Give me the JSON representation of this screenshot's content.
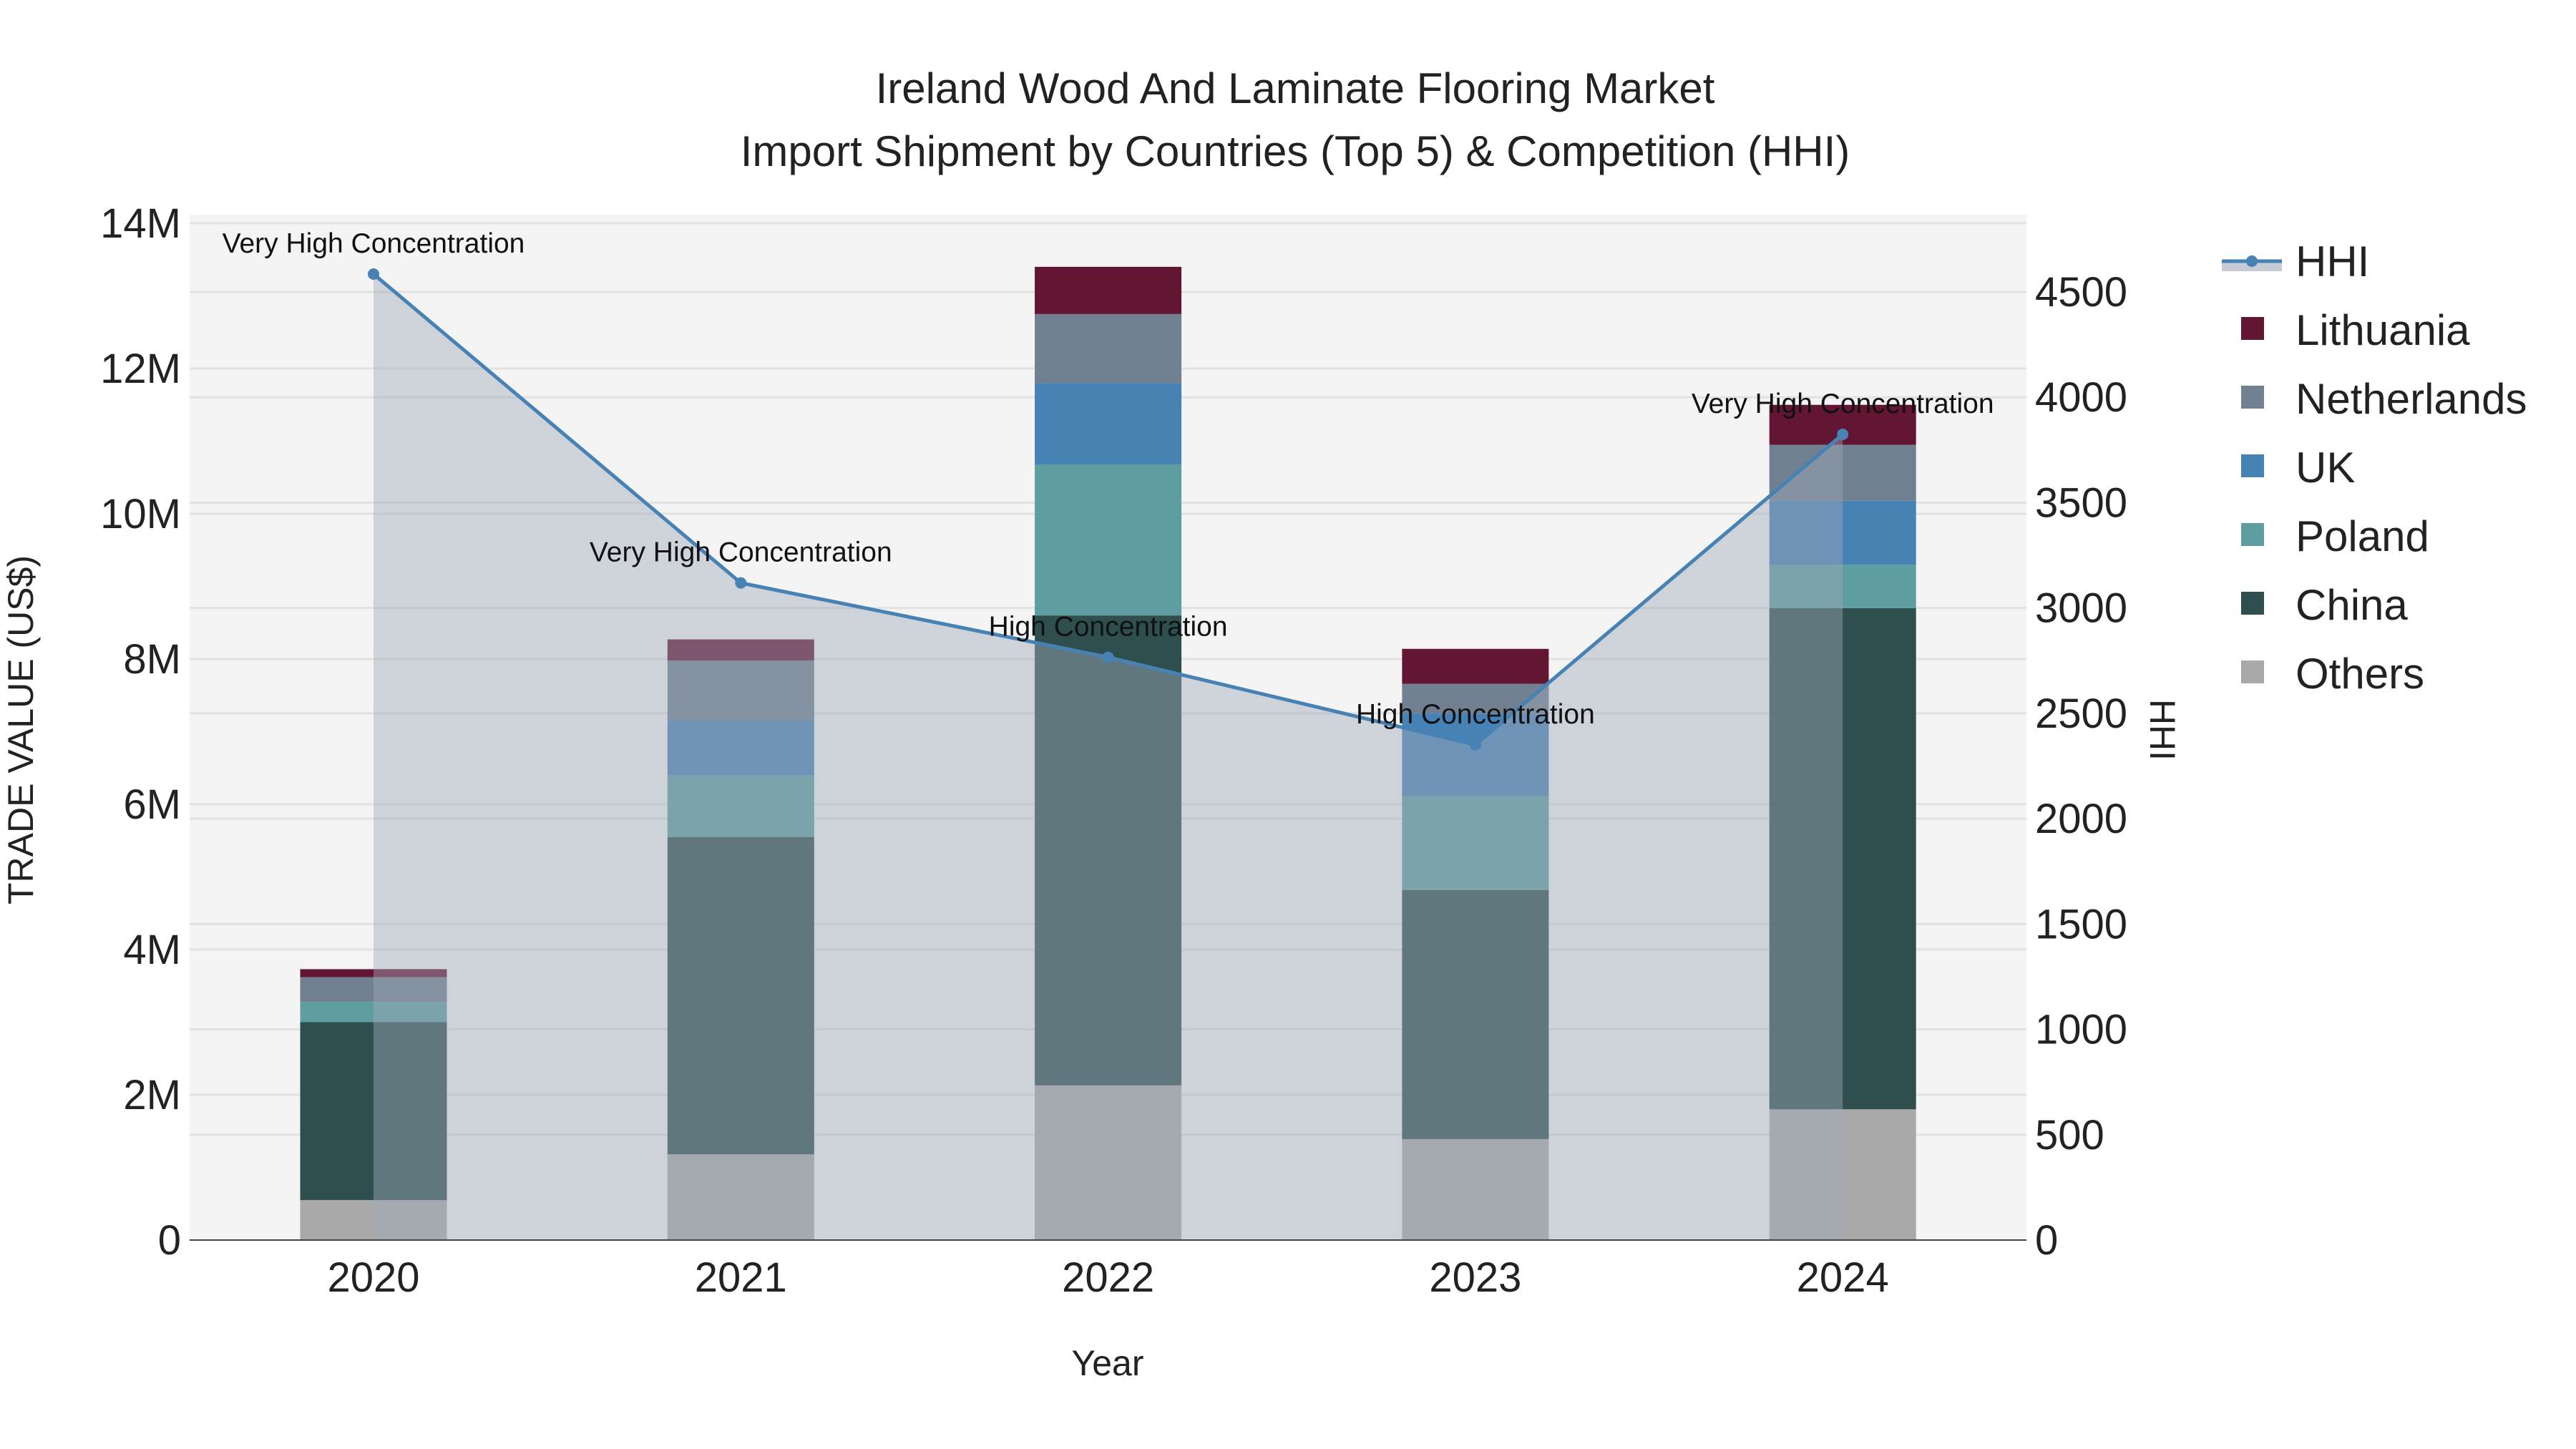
{
  "chart_data": {
    "type": "bar",
    "title": "Ireland Wood And Laminate Flooring Market",
    "subtitle": "Import Shipment by Countries (Top 5) & Competition (HHI)",
    "xlabel": "Year",
    "ylabel": "TRADE VALUE (US$)",
    "y2label": "HHI",
    "categories": [
      "2020",
      "2021",
      "2022",
      "2023",
      "2024"
    ],
    "ylim": [
      0,
      14000000
    ],
    "y_ticks": [
      0,
      2000000,
      4000000,
      6000000,
      8000000,
      10000000,
      12000000,
      14000000
    ],
    "y_tick_labels": [
      "0",
      "2M",
      "4M",
      "6M",
      "8M",
      "10M",
      "12M",
      "14M"
    ],
    "y2lim": [
      0,
      4850
    ],
    "y2_ticks": [
      0,
      500,
      1000,
      1500,
      2000,
      2500,
      3000,
      3500,
      4000,
      4500
    ],
    "y2_tick_labels": [
      "0",
      "500",
      "1000",
      "1500",
      "2000",
      "2500",
      "3000",
      "3500",
      "4000",
      "4500"
    ],
    "grid": true,
    "legend_placement": "right",
    "series": [
      {
        "name": "Others",
        "color": "#A9A9A9",
        "values": [
          550000,
          1180000,
          2130000,
          1390000,
          1800000
        ]
      },
      {
        "name": "China",
        "color": "#2F4F4F",
        "values": [
          2450000,
          4370000,
          6470000,
          3430000,
          6900000
        ]
      },
      {
        "name": "Poland",
        "color": "#5F9EA0",
        "values": [
          280000,
          850000,
          2080000,
          1290000,
          600000
        ]
      },
      {
        "name": "UK",
        "color": "#4682B4",
        "values": [
          0,
          760000,
          1120000,
          1140000,
          880000
        ]
      },
      {
        "name": "Netherlands",
        "color": "#708090",
        "values": [
          340000,
          820000,
          950000,
          410000,
          770000
        ]
      },
      {
        "name": "Lithuania",
        "color": "#631534",
        "values": [
          110000,
          290000,
          650000,
          480000,
          550000
        ]
      }
    ],
    "hhi": {
      "name": "HHI",
      "color": "#4682B4",
      "values": [
        4585,
        3119,
        2766,
        2351,
        3824
      ],
      "annotations": [
        "Very High Concentration",
        "Very High Concentration",
        "High Concentration",
        "High Concentration",
        "Very High Concentration"
      ]
    },
    "legend": [
      "HHI",
      "Lithuania",
      "Netherlands",
      "UK",
      "Poland",
      "China",
      "Others"
    ]
  }
}
